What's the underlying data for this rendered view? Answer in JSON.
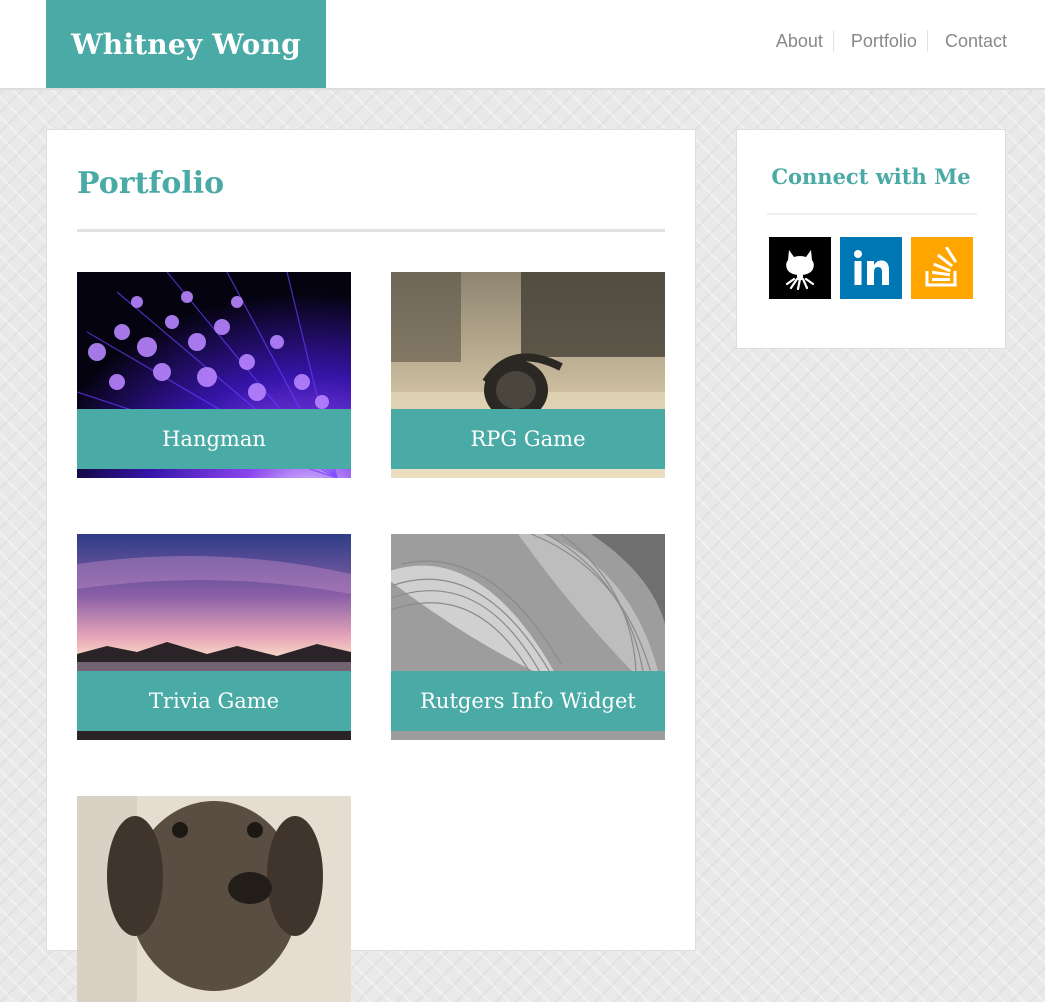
{
  "brand": {
    "name": "Whitney Wong",
    "color": "#4aaaa5"
  },
  "nav": {
    "items": [
      {
        "label": "About"
      },
      {
        "label": "Portfolio"
      },
      {
        "label": "Contact"
      }
    ]
  },
  "main": {
    "title": "Portfolio",
    "projects": [
      {
        "label": "Hangman",
        "image": "fiber-optic-lights"
      },
      {
        "label": "RPG Game",
        "image": "headphones-on-desk"
      },
      {
        "label": "Trivia Game",
        "image": "sunset-over-rocky-shore"
      },
      {
        "label": "Rutgers Info Widget",
        "image": "striped-leaves"
      },
      {
        "label": "",
        "image": "sad-dog"
      }
    ]
  },
  "sidebar": {
    "title": "Connect with Me",
    "links": [
      {
        "name": "GitHub",
        "icon": "github-icon",
        "color": "#000000"
      },
      {
        "name": "LinkedIn",
        "icon": "linkedin-icon",
        "color": "#0077b5"
      },
      {
        "name": "Stack Overflow",
        "icon": "stackoverflow-icon",
        "color": "#ffa500"
      }
    ]
  }
}
